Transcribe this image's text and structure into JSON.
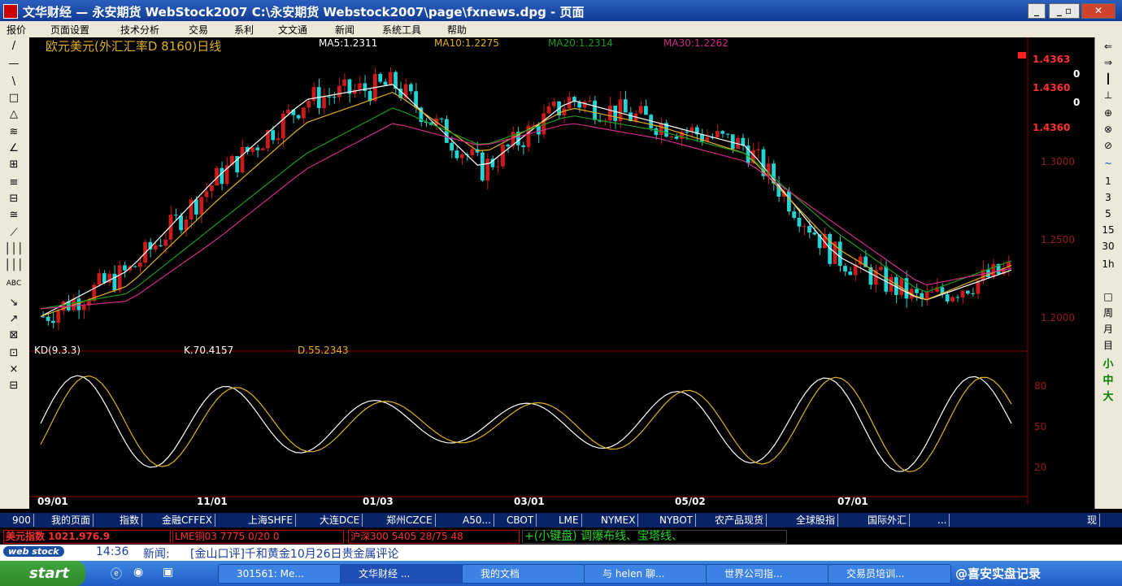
{
  "window": {
    "title": "文华财经 — 永安期货 WebStock2007     C:\\永安期货 Webstock2007\\page\\fxnews.dpg - 页面"
  },
  "menu": [
    "报价",
    "页面设置",
    "技术分析",
    "交易",
    "系利",
    "文文通",
    "新闻",
    "系统工具",
    "帮助"
  ],
  "chart": {
    "title": "欧元美元(外汇汇率D 8160)日线",
    "ma": [
      {
        "label": "MA5:1.2311",
        "color": "#ffffff"
      },
      {
        "label": "MA10:1.2275",
        "color": "#e0b020"
      },
      {
        "label": "MA20:1.2314",
        "color": "#1a9a1a"
      },
      {
        "label": "MA30:1.2262",
        "color": "#d02a8a"
      }
    ],
    "price_boxes": [
      "1.4363",
      "0",
      "1.4360",
      "0",
      "1.4360"
    ],
    "price_ticks": [
      "1.3000",
      "1.2500",
      "1.2000"
    ],
    "kd_header": {
      "name": "KD(9.3.3)",
      "k": "K.70.4157",
      "d": "D.55.2343"
    },
    "kd_ticks": [
      "80",
      "50",
      "20"
    ],
    "x_labels": [
      "09/01",
      "11/01",
      "01/03",
      "03/01",
      "05/02",
      "07/01"
    ],
    "colors": {
      "up": "#cc1a1a",
      "down": "#22d4d4",
      "ma5": "#ffffff",
      "ma10": "#e0b020",
      "ma20": "#1a9a1a",
      "ma30": "#d02a8a",
      "grid": "#8a0000"
    }
  },
  "chart_data": {
    "type": "line",
    "title": "欧元美元(外汇汇率D 8160)日线",
    "xlabel": "",
    "ylabel": "",
    "x": [
      "09/01",
      "10/01",
      "11/01",
      "12/01",
      "01/03",
      "02/01",
      "03/01",
      "04/01",
      "05/02",
      "06/01",
      "07/01",
      "08/01"
    ],
    "series": [
      {
        "name": "MA5:1.2311",
        "values": [
          1.195,
          1.225,
          1.285,
          1.335,
          1.345,
          1.29,
          1.335,
          1.32,
          1.305,
          1.235,
          1.205,
          1.225
        ]
      },
      {
        "name": "MA10:1.2275",
        "values": [
          1.195,
          1.215,
          1.27,
          1.32,
          1.34,
          1.3,
          1.33,
          1.318,
          1.3,
          1.24,
          1.205,
          1.228
        ]
      },
      {
        "name": "MA20:1.2314",
        "values": [
          1.2,
          1.21,
          1.255,
          1.3,
          1.33,
          1.305,
          1.325,
          1.315,
          1.3,
          1.25,
          1.21,
          1.231
        ]
      },
      {
        "name": "MA30:1.2262",
        "values": [
          1.2,
          1.205,
          1.245,
          1.29,
          1.32,
          1.305,
          1.32,
          1.31,
          1.295,
          1.255,
          1.215,
          1.226
        ]
      }
    ],
    "ylim": [
      1.18,
      1.37
    ]
  },
  "left_tools": [
    "/",
    "—",
    "\\",
    "□",
    "△",
    "≋",
    "∠",
    "⊞",
    "≡",
    "⊟",
    "≅",
    "⟋",
    "│││",
    "│││",
    "ABC",
    "↘",
    "↗",
    "⊠",
    "⊡",
    "×",
    "⊟"
  ],
  "right_tools": [
    "⇐",
    "⇒",
    "┃",
    "⊥",
    "⊕",
    "⊗",
    "⊘",
    "~",
    "1",
    "3",
    "5",
    "15",
    "30",
    "1h",
    "□",
    "周",
    "月",
    "目",
    "小",
    "中",
    "大"
  ],
  "tabs": [
    "900",
    "我的页面",
    "指数",
    "金融CFFEX",
    "上海SHFE",
    "大连DCE",
    "郑州CZCE",
    "A50...",
    "CBOT",
    "LME",
    "NYMEX",
    "NYBOT",
    "农产品现货",
    "全球股指",
    "国际外汇",
    "...",
    "现"
  ],
  "status": {
    "index": "美元指数  1021.976.9",
    "lme": "LME铜03  7775 0/20 0",
    "hs300": "沪深300  5405 28/75 48",
    "ticker": "+(小键盘) 调爆布线、宝塔线、"
  },
  "news": {
    "logo": "web stock",
    "time": "14:36",
    "label": "新闻:",
    "text": "[金山口评]千和黄金10月26日贵金属评论"
  },
  "taskbar": {
    "start": "start",
    "tasks": [
      "301561: Me...",
      "文华财经 ...",
      "我的文档",
      "与 helen 聊...",
      "世界公司指...",
      "交易员培训..."
    ],
    "watermark": "@喜安实盘记录"
  }
}
